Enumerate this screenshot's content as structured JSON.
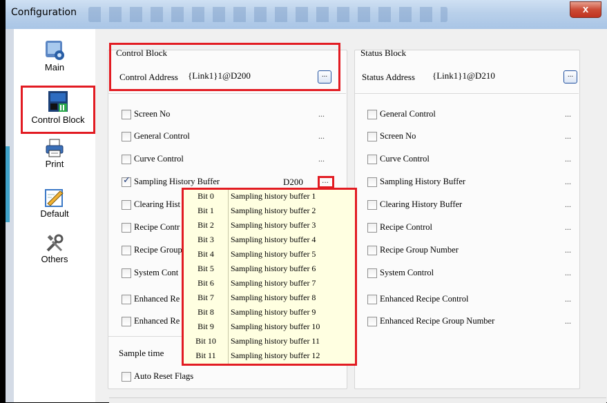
{
  "window": {
    "title": "Configuration",
    "close_label": "x"
  },
  "sidebar": {
    "items": [
      {
        "label": "Main",
        "icon": "main-icon"
      },
      {
        "label": "Control Block",
        "icon": "control-block-icon",
        "selected": true
      },
      {
        "label": "Print",
        "icon": "printer-icon"
      },
      {
        "label": "Default",
        "icon": "default-icon"
      },
      {
        "label": "Others",
        "icon": "tools-icon"
      }
    ]
  },
  "control_block": {
    "title": "Control Block",
    "address_label": "Control Address",
    "address_value": "{Link1}1@D200",
    "browse_label": "...",
    "items": [
      {
        "label": "Screen No",
        "checked": false,
        "value": "",
        "dots": "..."
      },
      {
        "label": "General Control",
        "checked": false,
        "value": "",
        "dots": "..."
      },
      {
        "label": "Curve Control",
        "checked": false,
        "value": "",
        "dots": "..."
      },
      {
        "label": "Sampling History Buffer",
        "checked": true,
        "value": "D200",
        "dots": "..."
      },
      {
        "label": "Clearing History Buffer",
        "checked": false,
        "value": "",
        "dots": "..."
      },
      {
        "label": "Recipe Control",
        "checked": false,
        "value": "",
        "dots": "..."
      },
      {
        "label": "Recipe Group Number",
        "checked": false,
        "value": "",
        "dots": "..."
      },
      {
        "label": "System Control",
        "checked": false,
        "value": "",
        "dots": "..."
      },
      {
        "label": "Enhanced Recipe Control",
        "checked": false,
        "value": "",
        "dots": "..."
      },
      {
        "label": "Enhanced Recipe Group Number",
        "checked": false,
        "value": "",
        "dots": "..."
      }
    ],
    "visible_labels": [
      "Screen No",
      "General Control",
      "Curve Control",
      "Sampling History Buffer",
      "Clearing Hist",
      "Recipe Contr",
      "Recipe Group",
      "System Cont",
      "Enhanced Re",
      "Enhanced Re"
    ],
    "sample_time_label": "Sample time",
    "auto_reset_label": "Auto Reset Flags"
  },
  "status_block": {
    "title": "Status Block",
    "address_label": "Status Address",
    "address_value": "{Link1}1@D210",
    "browse_label": "...",
    "items": [
      {
        "label": "General Control",
        "checked": false,
        "dots": "..."
      },
      {
        "label": "Screen No",
        "checked": false,
        "dots": "..."
      },
      {
        "label": "Curve Control",
        "checked": false,
        "dots": "..."
      },
      {
        "label": "Sampling History Buffer",
        "checked": false,
        "dots": "..."
      },
      {
        "label": "Clearing History Buffer",
        "checked": false,
        "dots": "..."
      },
      {
        "label": "Recipe Control",
        "checked": false,
        "dots": "..."
      },
      {
        "label": "Recipe Group Number",
        "checked": false,
        "dots": "..."
      },
      {
        "label": "System Control",
        "checked": false,
        "dots": "..."
      },
      {
        "label": "Enhanced Recipe Control",
        "checked": false,
        "dots": "..."
      },
      {
        "label": "Enhanced Recipe Group Number",
        "checked": false,
        "dots": "..."
      }
    ]
  },
  "popup": {
    "rows": [
      {
        "bit": "Bit 0",
        "desc": "Sampling history buffer 1"
      },
      {
        "bit": "Bit 1",
        "desc": "Sampling history buffer 2"
      },
      {
        "bit": "Bit 2",
        "desc": "Sampling history buffer 3"
      },
      {
        "bit": "Bit 3",
        "desc": "Sampling history buffer 4"
      },
      {
        "bit": "Bit 4",
        "desc": "Sampling history buffer 5"
      },
      {
        "bit": "Bit 5",
        "desc": "Sampling history buffer 6"
      },
      {
        "bit": "Bit 6",
        "desc": "Sampling history buffer 7"
      },
      {
        "bit": "Bit 7",
        "desc": "Sampling history buffer 8"
      },
      {
        "bit": "Bit 8",
        "desc": "Sampling history buffer 9"
      },
      {
        "bit": "Bit 9",
        "desc": "Sampling history buffer 10"
      },
      {
        "bit": "Bit 10",
        "desc": "Sampling history buffer 11"
      },
      {
        "bit": "Bit 11",
        "desc": "Sampling history buffer 12"
      }
    ]
  },
  "colors": {
    "highlight": "#e21b22",
    "popup_bg": "#ffffe1",
    "titlebar": "#b9d0ea",
    "close": "#c03320"
  }
}
